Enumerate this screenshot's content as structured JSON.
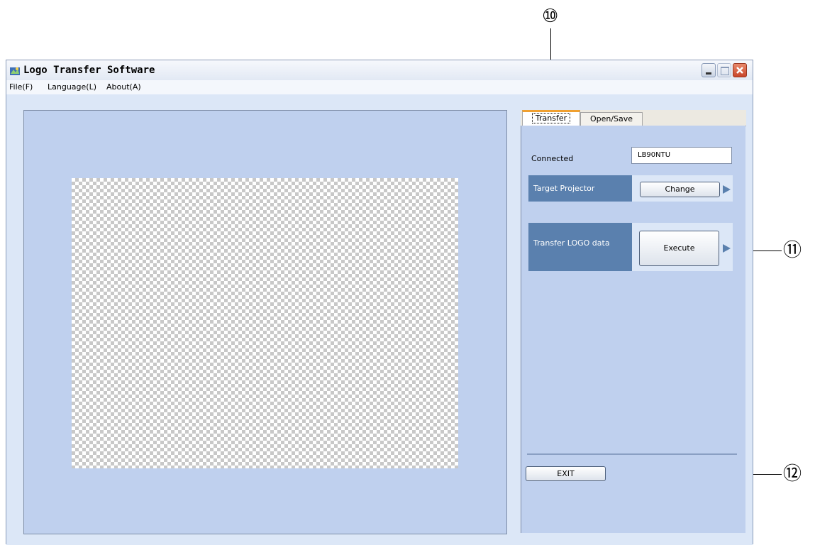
{
  "callouts": {
    "tab": "⑩",
    "execute": "⑪",
    "exit": "⑫"
  },
  "window": {
    "title": "Logo Transfer Software",
    "icon": "app-logo-icon",
    "controls": [
      "minimize-icon",
      "maximize-icon",
      "close-icon"
    ]
  },
  "menu": {
    "file": "File(F)",
    "language": "Language(L)",
    "about": "About(A)"
  },
  "tabs": {
    "transfer": "Transfer",
    "open_save": "Open/Save"
  },
  "transfer": {
    "connected_label": "Connected",
    "connected_value": "LB90NTU",
    "target_label": "Target Projector",
    "change_button": "Change",
    "logo_label": "Transfer LOGO data",
    "execute_button": "Execute",
    "exit_button": "EXIT"
  },
  "colors": {
    "panel_blue": "#bfd0ee",
    "header_blue": "#5a80ae",
    "active_tab_accent": "#f0a030"
  }
}
